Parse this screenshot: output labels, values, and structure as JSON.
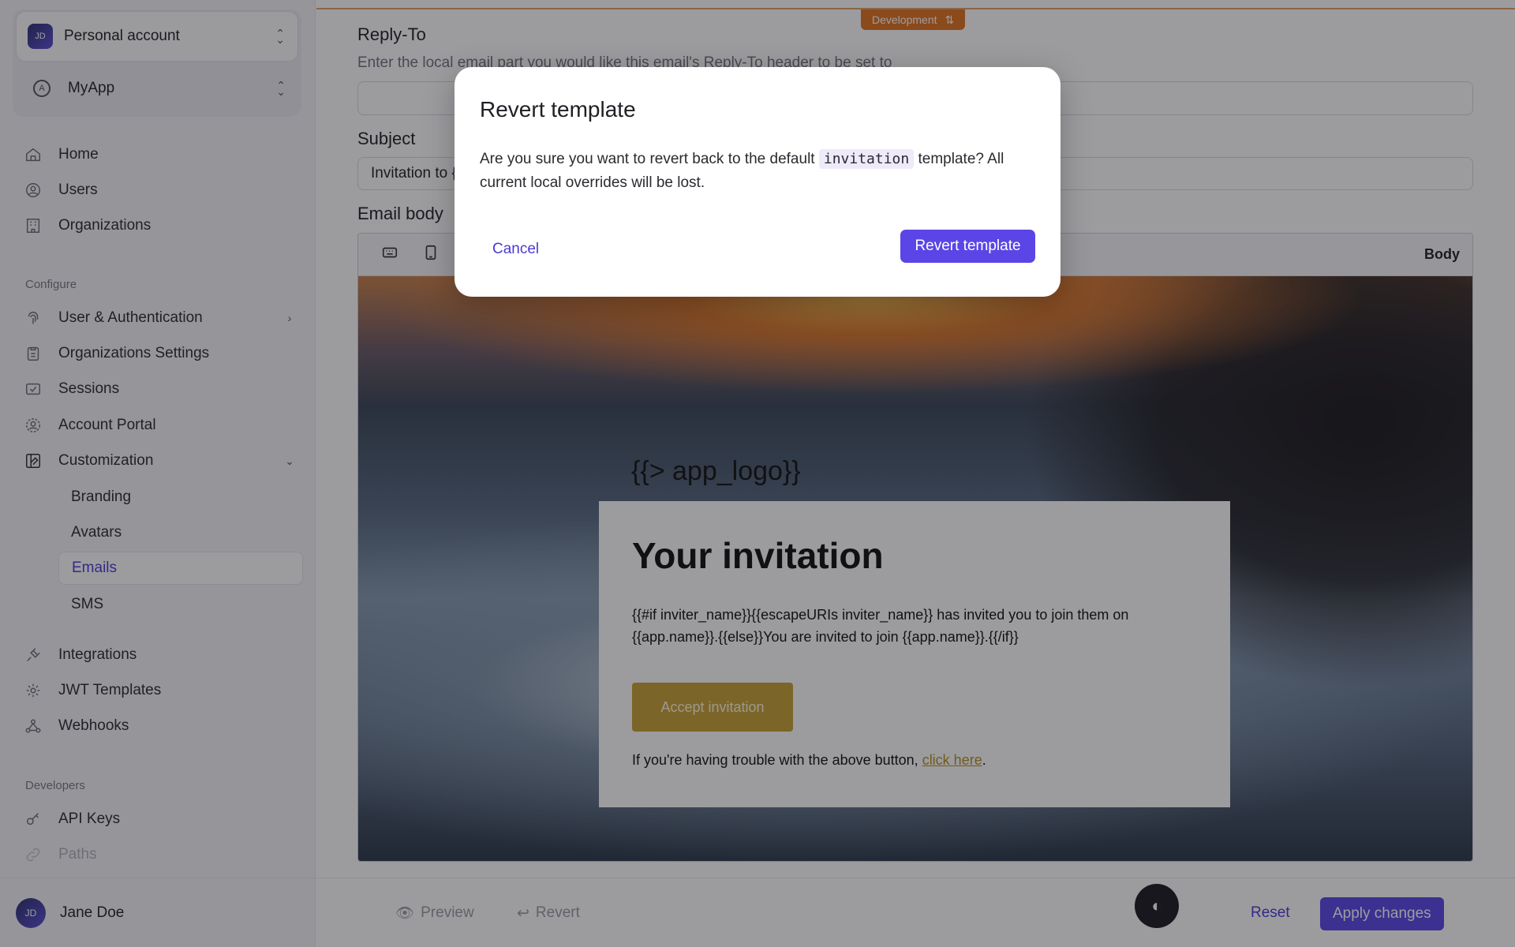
{
  "sidebar": {
    "account": {
      "avatar_initials": "JD",
      "label": "Personal account"
    },
    "app": {
      "label": "MyApp"
    },
    "nav_top": [
      {
        "label": "Home",
        "icon": "home-icon"
      },
      {
        "label": "Users",
        "icon": "user-circle-icon"
      },
      {
        "label": "Organizations",
        "icon": "building-icon"
      }
    ],
    "configure_label": "Configure",
    "configure": [
      {
        "label": "User & Authentication",
        "icon": "fingerprint-icon"
      },
      {
        "label": "Organizations Settings",
        "icon": "clipboard-icon"
      },
      {
        "label": "Sessions",
        "icon": "session-icon"
      },
      {
        "label": "Account Portal",
        "icon": "portal-icon"
      },
      {
        "label": "Customization",
        "icon": "customization-icon"
      }
    ],
    "customization_sub": [
      {
        "label": "Branding"
      },
      {
        "label": "Avatars"
      },
      {
        "label": "Emails"
      },
      {
        "label": "SMS"
      }
    ],
    "more": [
      {
        "label": "Integrations",
        "icon": "plug-icon"
      },
      {
        "label": "JWT Templates",
        "icon": "gear-icon"
      },
      {
        "label": "Webhooks",
        "icon": "webhook-icon"
      }
    ],
    "developers_label": "Developers",
    "developers": [
      {
        "label": "API Keys",
        "icon": "key-icon"
      },
      {
        "label": "Paths",
        "icon": "link-icon"
      }
    ],
    "user": {
      "avatar_initials": "JD",
      "name": "Jane Doe"
    }
  },
  "main": {
    "env_badge": "Development",
    "reply_to": {
      "title": "Reply-To",
      "description": "Enter the local email part you would like this email's Reply-To header to be set to",
      "value": ""
    },
    "subject": {
      "title": "Subject",
      "value": "Invitation to {"
    },
    "email_body_title": "Email body",
    "editor": {
      "mode_label": "Body",
      "preview": {
        "logo_text": "{{> app_logo}}",
        "heading": "Your invitation",
        "text": "{{#if inviter_name}}{{escapeURIs inviter_name}} has invited you to join them on {{app.name}}.{{else}}You are invited to join {{app.name}}.{{/if}}",
        "button": "Accept invitation",
        "trouble_text": "If you're having trouble with the above button, ",
        "trouble_link": "click here",
        "trouble_end": "."
      }
    },
    "footer": {
      "preview": "Preview",
      "revert": "Revert",
      "reset": "Reset",
      "apply": "Apply changes"
    }
  },
  "modal": {
    "title": "Revert template",
    "body_before": "Are you sure you want to revert back to the default ",
    "code": "invitation",
    "body_after": " template? All current local overrides will be lost.",
    "cancel": "Cancel",
    "confirm": "Revert template"
  },
  "colors": {
    "accent": "#5b45e6",
    "env_badge": "#e2731e",
    "email_button": "#c9a132"
  }
}
